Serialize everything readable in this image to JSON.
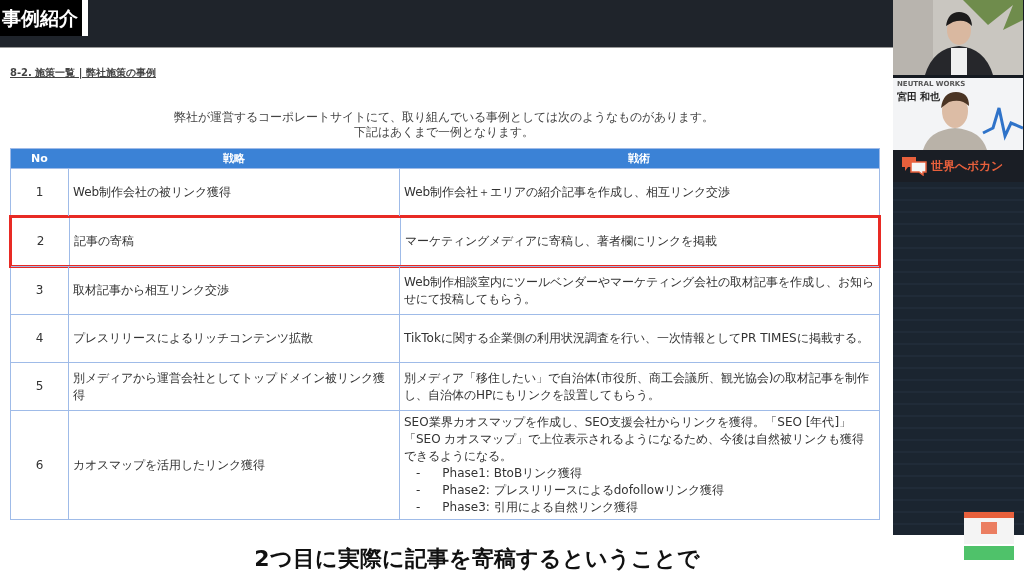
{
  "slide": {
    "title": "事例紹介",
    "section": "8-2. 施策一覧 | 弊社施策の事例",
    "intro": [
      "弊社が運営するコーポレートサイトにて、取り組んでいる事例としては次のようなものがあります。",
      "下記はあくまで一例となります。"
    ]
  },
  "table": {
    "columns": [
      "No",
      "戦略",
      "戦術"
    ],
    "rows": [
      {
        "no": "1",
        "strategy": "Web制作会社の被リンク獲得",
        "tactic": "Web制作会社＋エリアの紹介記事を作成し、相互リンク交渉",
        "highlighted": false
      },
      {
        "no": "2",
        "strategy": "記事の寄稿",
        "tactic": "マーケティングメディアに寄稿し、著者欄にリンクを掲載",
        "highlighted": true
      },
      {
        "no": "3",
        "strategy": "取材記事から相互リンク交渉",
        "tactic": "Web制作相談室内にツールベンダーやマーケティング会社の取材記事を作成し、お知らせにて投稿してもらう。",
        "highlighted": false
      },
      {
        "no": "4",
        "strategy": "プレスリリースによるリッチコンテンツ拡散",
        "tactic": "TikTokに関する企業側の利用状況調査を行い、一次情報としてPR TIMESに掲載する。",
        "highlighted": false
      },
      {
        "no": "5",
        "strategy": "別メディアから運営会社としてトップドメイン被リンク獲得",
        "tactic": "別メディア「移住したい」で自治体(市役所、商工会議所、観光協会)の取材記事を制作し、自治体のHPにもリンクを設置してもらう。",
        "highlighted": false
      },
      {
        "no": "6",
        "strategy": "カオスマップを活用したリンク獲得",
        "tactic": "SEO業界カオスマップを作成し、SEO支援会社からリンクを獲得。「SEO [年代]」「SEO カオスマップ」で上位表示されるようになるため、今後は自然被リンクも獲得できるようになる。",
        "highlighted": false,
        "bullets": [
          {
            "marker": "-",
            "text": "Phase1: BtoBリンク獲得"
          },
          {
            "marker": "-",
            "text": "Phase2: プレスリリースによるdofollowリンク獲得"
          },
          {
            "marker": "-",
            "text": "Phase3: 引用による自然リンク獲得"
          }
        ]
      }
    ]
  },
  "caption": "2つ目に実際に記事を寄稿するということで",
  "sidebar": {
    "company": "NEUTRAL WORKS",
    "speaker_name": "宮田 和也",
    "logo_text": "世界へボカン"
  }
}
